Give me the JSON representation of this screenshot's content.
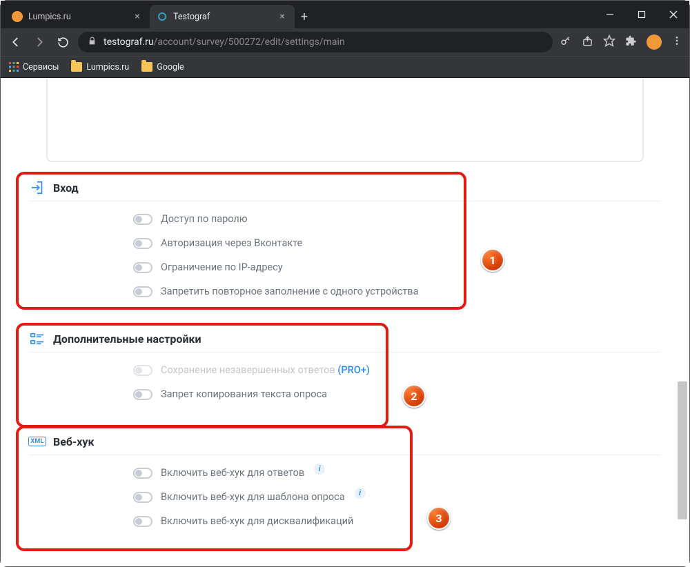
{
  "browser": {
    "tabs": [
      {
        "title": "Lumpics.ru",
        "active": false
      },
      {
        "title": "Testograf",
        "active": true
      }
    ],
    "url_host": "testograf.ru",
    "url_path": "/account/survey/500272/edit/settings/main",
    "bookmarks": {
      "services": "Сервисы",
      "lumpics": "Lumpics.ru",
      "google": "Google"
    }
  },
  "sections": {
    "login": {
      "title": "Вход",
      "items": [
        "Доступ по паролю",
        "Авторизация через Вконтакте",
        "Ограничение по IP-адресу",
        "Запретить повторное заполнение с одного устройства"
      ]
    },
    "extra": {
      "title": "Дополнительные настройки",
      "items": [
        "Сохранение незавершенных ответов",
        "Запрет копирования текста опроса"
      ],
      "pro_label": "(PRO+)"
    },
    "webhook": {
      "title": "Веб-хук",
      "xml": "XML",
      "items": [
        "Включить веб-хук для ответов",
        "Включить веб-хук для шаблона опроса",
        "Включить веб-хук для дисквалификаций"
      ]
    }
  },
  "callouts": {
    "c1": "1",
    "c2": "2",
    "c3": "3"
  }
}
